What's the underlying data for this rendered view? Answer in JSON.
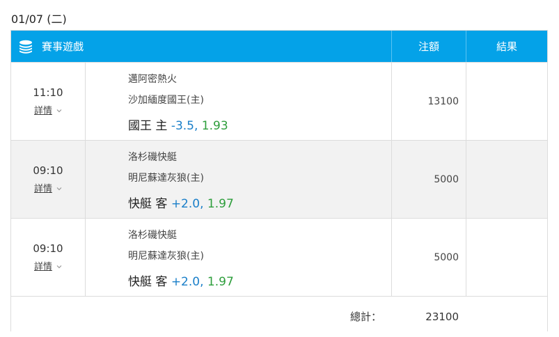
{
  "date": "01/07 (二)",
  "header": {
    "section_label": "賽事遊戲",
    "bet_label": "注額",
    "result_label": "結果",
    "icon": "coin-stack-icon"
  },
  "rows": [
    {
      "time": "11:10",
      "details": "詳情",
      "team1": "邁阿密熱火",
      "team2": "沙加緬度國王(主)",
      "pick_team": "國王 主",
      "handicap": "-3.5,",
      "odds": "1.93",
      "amount": "13100",
      "result": ""
    },
    {
      "time": "09:10",
      "details": "詳情",
      "team1": "洛杉磯快艇",
      "team2": "明尼蘇達灰狼(主)",
      "pick_team": "快艇 客",
      "handicap": "+2.0,",
      "odds": "1.97",
      "amount": "5000",
      "result": ""
    },
    {
      "time": "09:10",
      "details": "詳情",
      "team1": "洛杉磯快艇",
      "team2": "明尼蘇達灰狼(主)",
      "pick_team": "快艇 客",
      "handicap": "+2.0,",
      "odds": "1.97",
      "amount": "5000",
      "result": ""
    }
  ],
  "footer": {
    "total_label": "總計：",
    "total_value": "23100"
  },
  "colors": {
    "header_bg": "#04a2e8",
    "handicap": "#1a7fc9",
    "odds": "#2e9e3c"
  }
}
